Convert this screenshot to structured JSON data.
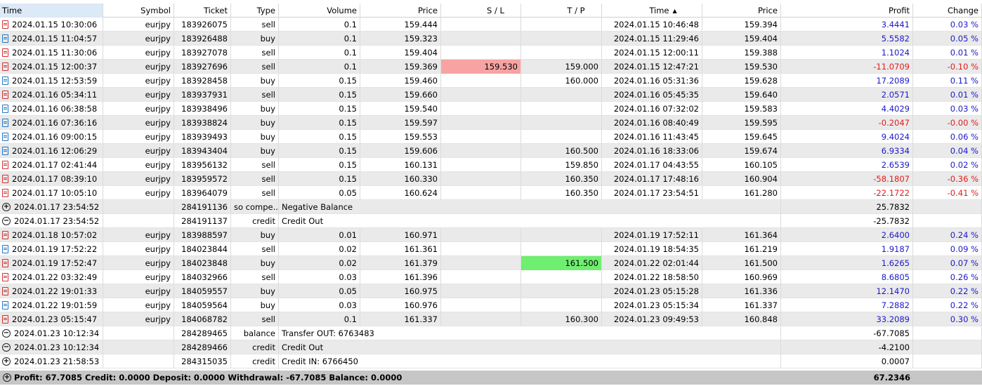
{
  "columns": {
    "time": "Time",
    "symbol": "Symbol",
    "ticket": "Ticket",
    "type": "Type",
    "volume": "Volume",
    "price": "Price",
    "sl": "S / L",
    "tp": "T / P",
    "time2": "Time",
    "price2": "Price",
    "profit": "Profit",
    "change": "Change",
    "sort_indicator": "▲"
  },
  "rows": [
    {
      "kind": "deal",
      "icon": "sell",
      "time": "2024.01.15 10:30:06",
      "symbol": "eurjpy",
      "ticket": "183926075",
      "type": "sell",
      "volume": "0.1",
      "price": "159.444",
      "sl": "",
      "tp": "",
      "time2": "2024.01.15 10:46:48",
      "price2": "159.394",
      "profit": "3.4441",
      "change": "0.03 %"
    },
    {
      "kind": "deal",
      "icon": "buy",
      "time": "2024.01.15 11:04:57",
      "symbol": "eurjpy",
      "ticket": "183926488",
      "type": "buy",
      "volume": "0.1",
      "price": "159.323",
      "sl": "",
      "tp": "",
      "time2": "2024.01.15 11:29:46",
      "price2": "159.404",
      "profit": "5.5582",
      "change": "0.05 %"
    },
    {
      "kind": "deal",
      "icon": "sell",
      "time": "2024.01.15 11:30:06",
      "symbol": "eurjpy",
      "ticket": "183927078",
      "type": "sell",
      "volume": "0.1",
      "price": "159.404",
      "sl": "",
      "tp": "",
      "time2": "2024.01.15 12:00:11",
      "price2": "159.388",
      "profit": "1.1024",
      "change": "0.01 %"
    },
    {
      "kind": "deal",
      "icon": "sell",
      "time": "2024.01.15 12:00:37",
      "symbol": "eurjpy",
      "ticket": "183927696",
      "type": "sell",
      "volume": "0.1",
      "price": "159.369",
      "sl": "159.530",
      "tp": "159.000",
      "time2": "2024.01.15 12:47:21",
      "price2": "159.530",
      "profit": "-11.0709",
      "change": "-0.10 %",
      "hit": "sl"
    },
    {
      "kind": "deal",
      "icon": "buy",
      "time": "2024.01.15 12:53:59",
      "symbol": "eurjpy",
      "ticket": "183928458",
      "type": "buy",
      "volume": "0.15",
      "price": "159.460",
      "sl": "",
      "tp": "160.000",
      "time2": "2024.01.16 05:31:36",
      "price2": "159.628",
      "profit": "17.2089",
      "change": "0.11 %"
    },
    {
      "kind": "deal",
      "icon": "sell",
      "time": "2024.01.16 05:34:11",
      "symbol": "eurjpy",
      "ticket": "183937931",
      "type": "sell",
      "volume": "0.15",
      "price": "159.660",
      "sl": "",
      "tp": "",
      "time2": "2024.01.16 05:45:35",
      "price2": "159.640",
      "profit": "2.0571",
      "change": "0.01 %"
    },
    {
      "kind": "deal",
      "icon": "buy",
      "time": "2024.01.16 06:38:58",
      "symbol": "eurjpy",
      "ticket": "183938496",
      "type": "buy",
      "volume": "0.15",
      "price": "159.540",
      "sl": "",
      "tp": "",
      "time2": "2024.01.16 07:32:02",
      "price2": "159.583",
      "profit": "4.4029",
      "change": "0.03 %"
    },
    {
      "kind": "deal",
      "icon": "buy",
      "time": "2024.01.16 07:36:16",
      "symbol": "eurjpy",
      "ticket": "183938824",
      "type": "buy",
      "volume": "0.15",
      "price": "159.597",
      "sl": "",
      "tp": "",
      "time2": "2024.01.16 08:40:49",
      "price2": "159.595",
      "profit": "-0.2047",
      "change": "-0.00 %"
    },
    {
      "kind": "deal",
      "icon": "buy",
      "time": "2024.01.16 09:00:15",
      "symbol": "eurjpy",
      "ticket": "183939493",
      "type": "buy",
      "volume": "0.15",
      "price": "159.553",
      "sl": "",
      "tp": "",
      "time2": "2024.01.16 11:43:45",
      "price2": "159.645",
      "profit": "9.4024",
      "change": "0.06 %"
    },
    {
      "kind": "deal",
      "icon": "buy",
      "time": "2024.01.16 12:06:29",
      "symbol": "eurjpy",
      "ticket": "183943404",
      "type": "buy",
      "volume": "0.15",
      "price": "159.606",
      "sl": "",
      "tp": "160.500",
      "time2": "2024.01.16 18:33:06",
      "price2": "159.674",
      "profit": "6.9334",
      "change": "0.04 %"
    },
    {
      "kind": "deal",
      "icon": "sell",
      "time": "2024.01.17 02:41:44",
      "symbol": "eurjpy",
      "ticket": "183956132",
      "type": "sell",
      "volume": "0.15",
      "price": "160.131",
      "sl": "",
      "tp": "159.850",
      "time2": "2024.01.17 04:43:55",
      "price2": "160.105",
      "profit": "2.6539",
      "change": "0.02 %"
    },
    {
      "kind": "deal",
      "icon": "sell",
      "time": "2024.01.17 08:39:10",
      "symbol": "eurjpy",
      "ticket": "183959572",
      "type": "sell",
      "volume": "0.15",
      "price": "160.330",
      "sl": "",
      "tp": "160.350",
      "time2": "2024.01.17 17:48:16",
      "price2": "160.904",
      "profit": "-58.1807",
      "change": "-0.36 %"
    },
    {
      "kind": "deal",
      "icon": "sell",
      "time": "2024.01.17 10:05:10",
      "symbol": "eurjpy",
      "ticket": "183964079",
      "type": "sell",
      "volume": "0.05",
      "price": "160.624",
      "sl": "",
      "tp": "160.350",
      "time2": "2024.01.17 23:54:51",
      "price2": "161.280",
      "profit": "-22.1722",
      "change": "-0.41 %"
    },
    {
      "kind": "op",
      "icon": "plus",
      "time": "2024.01.17 23:54:52",
      "ticket": "284191136",
      "type": "so compe...",
      "comment": "Negative Balance",
      "profit": "25.7832"
    },
    {
      "kind": "op",
      "icon": "minus",
      "time": "2024.01.17 23:54:52",
      "ticket": "284191137",
      "type": "credit",
      "comment": "Credit Out",
      "profit": "-25.7832"
    },
    {
      "kind": "deal",
      "icon": "sell",
      "time": "2024.01.18 10:57:02",
      "symbol": "eurjpy",
      "ticket": "183988597",
      "type": "buy",
      "volume": "0.01",
      "price": "160.971",
      "sl": "",
      "tp": "",
      "time2": "2024.01.19 17:52:11",
      "price2": "161.364",
      "profit": "2.6400",
      "change": "0.24 %"
    },
    {
      "kind": "deal",
      "icon": "buy",
      "time": "2024.01.19 17:52:22",
      "symbol": "eurjpy",
      "ticket": "184023844",
      "type": "sell",
      "volume": "0.02",
      "price": "161.361",
      "sl": "",
      "tp": "",
      "time2": "2024.01.19 18:54:35",
      "price2": "161.219",
      "profit": "1.9187",
      "change": "0.09 %"
    },
    {
      "kind": "deal",
      "icon": "sell",
      "time": "2024.01.19 17:52:47",
      "symbol": "eurjpy",
      "ticket": "184023848",
      "type": "buy",
      "volume": "0.02",
      "price": "161.379",
      "sl": "",
      "tp": "161.500",
      "time2": "2024.01.22 02:01:44",
      "price2": "161.500",
      "profit": "1.6265",
      "change": "0.07 %",
      "hit": "tp"
    },
    {
      "kind": "deal",
      "icon": "sell",
      "time": "2024.01.22 03:32:49",
      "symbol": "eurjpy",
      "ticket": "184032966",
      "type": "sell",
      "volume": "0.03",
      "price": "161.396",
      "sl": "",
      "tp": "",
      "time2": "2024.01.22 18:58:50",
      "price2": "160.969",
      "profit": "8.6805",
      "change": "0.26 %"
    },
    {
      "kind": "deal",
      "icon": "sell",
      "time": "2024.01.22 19:01:33",
      "symbol": "eurjpy",
      "ticket": "184059557",
      "type": "buy",
      "volume": "0.05",
      "price": "160.975",
      "sl": "",
      "tp": "",
      "time2": "2024.01.23 05:15:28",
      "price2": "161.336",
      "profit": "12.1470",
      "change": "0.22 %"
    },
    {
      "kind": "deal",
      "icon": "buy",
      "time": "2024.01.22 19:01:59",
      "symbol": "eurjpy",
      "ticket": "184059564",
      "type": "buy",
      "volume": "0.03",
      "price": "160.976",
      "sl": "",
      "tp": "",
      "time2": "2024.01.23 05:15:34",
      "price2": "161.337",
      "profit": "7.2882",
      "change": "0.22 %"
    },
    {
      "kind": "deal",
      "icon": "sell",
      "time": "2024.01.23 05:15:47",
      "symbol": "eurjpy",
      "ticket": "184068782",
      "type": "sell",
      "volume": "0.1",
      "price": "161.337",
      "sl": "",
      "tp": "160.300",
      "time2": "2024.01.23 09:49:53",
      "price2": "160.848",
      "profit": "33.2089",
      "change": "0.30 %"
    },
    {
      "kind": "op",
      "icon": "minus",
      "time": "2024.01.23 10:12:34",
      "ticket": "284289465",
      "type": "balance",
      "comment": "Transfer OUT: 6763483",
      "profit": "-67.7085"
    },
    {
      "kind": "op",
      "icon": "minus",
      "time": "2024.01.23 10:12:34",
      "ticket": "284289466",
      "type": "credit",
      "comment": "Credit Out",
      "profit": "-4.2100"
    },
    {
      "kind": "op",
      "icon": "plus",
      "time": "2024.01.23 21:58:53",
      "ticket": "284315035",
      "type": "credit",
      "comment": "Credit IN: 6766450",
      "profit": "0.0007"
    }
  ],
  "footer": {
    "summary": "Profit: 67.7085  Credit: 0.0000  Deposit: 0.0000  Withdrawal: -67.7085  Balance: 0.0000",
    "total": "67.2346"
  },
  "colors": {
    "positive": "#1a1ac8",
    "negative": "#e11c1c",
    "sl_hit": "#f7a3a3",
    "tp_hit": "#6fef6f",
    "header_selected": "#dce9f6",
    "footer_bg": "#c6c6c6"
  }
}
